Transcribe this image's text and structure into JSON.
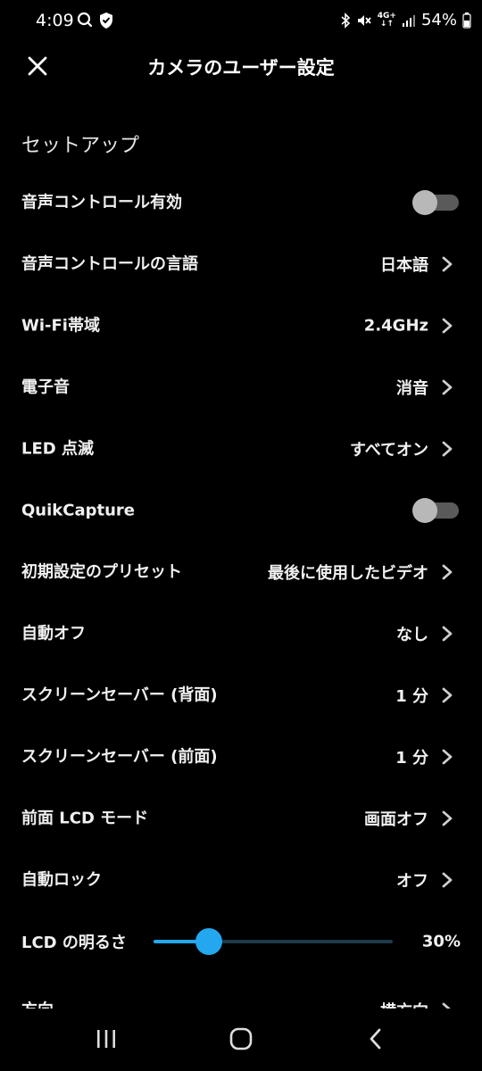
{
  "status_bar": {
    "time": "4:09",
    "left_icons": [
      "search-icon",
      "shield-icon"
    ],
    "right_icons": [
      "bluetooth-icon",
      "mute-icon",
      "lte-icon",
      "signal-icon",
      "battery-icon"
    ],
    "network": "4G+",
    "battery": "54%"
  },
  "header": {
    "title": "カメラのユーザー設定",
    "close_icon": "close-icon"
  },
  "section": {
    "title": "セットアップ"
  },
  "settings": [
    {
      "label": "音声コントロール有効",
      "type": "toggle",
      "state": "off"
    },
    {
      "label": "音声コントロールの言語",
      "type": "link",
      "value": "日本語"
    },
    {
      "label": "Wi-Fi帯域",
      "type": "link",
      "value": "2.4GHz"
    },
    {
      "label": "電子音",
      "type": "link",
      "value": "消音"
    },
    {
      "label": "LED 点滅",
      "type": "link",
      "value": "すべてオン"
    },
    {
      "label": "QuikCapture",
      "type": "toggle",
      "state": "off"
    },
    {
      "label": "初期設定のプリセット",
      "type": "link",
      "value": "最後に使用したビデオ"
    },
    {
      "label": "自動オフ",
      "type": "link",
      "value": "なし"
    },
    {
      "label": "スクリーンセーバー (背面)",
      "type": "link",
      "value": "1 分"
    },
    {
      "label": "スクリーンセーバー (前面)",
      "type": "link",
      "value": "1 分"
    },
    {
      "label": "前面 LCD モード",
      "type": "link",
      "value": "画面オフ"
    },
    {
      "label": "自動ロック",
      "type": "link",
      "value": "オフ"
    }
  ],
  "brightness": {
    "label": "LCD の明るさ",
    "value_text": "30%",
    "fraction": 0.23
  },
  "partial_row": {
    "label": "方向",
    "value": "横方向"
  },
  "colors": {
    "accent": "#23a8f0",
    "background": "#000000",
    "toggle_off_track": "#5a5a5a",
    "toggle_off_knob": "#b8b8b8"
  },
  "nav": {
    "recents_icon": "recents-icon",
    "home_icon": "home-icon",
    "back_icon": "back-icon"
  }
}
